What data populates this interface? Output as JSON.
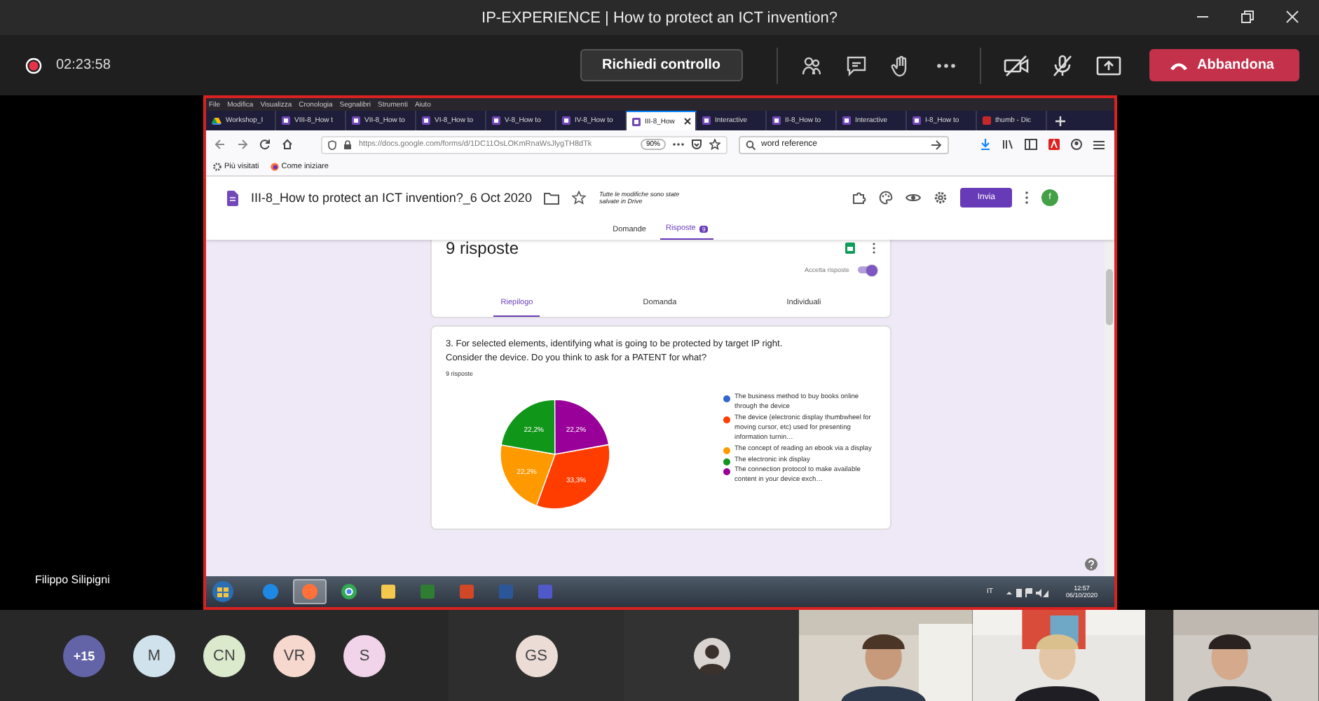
{
  "window": {
    "title": "IP-EXPERIENCE | How to protect an ICT invention?"
  },
  "call_bar": {
    "elapsed": "02:23:58",
    "request_button": "Richiedi controllo",
    "leave_button": "Abbandona"
  },
  "presenter": {
    "name": "Filippo Silipigni"
  },
  "shared_screen": {
    "menu": [
      "File",
      "Modifica",
      "Visualizza",
      "Cronologia",
      "Segnalibri",
      "Strumenti",
      "Aiuto"
    ],
    "tabs": [
      {
        "label": "Workshop_I",
        "kind": "drive",
        "selected": false
      },
      {
        "label": "VIII-8_How t",
        "kind": "forms",
        "selected": false
      },
      {
        "label": "VII-8_How to",
        "kind": "forms",
        "selected": false
      },
      {
        "label": "VI-8_How to",
        "kind": "forms",
        "selected": false
      },
      {
        "label": "V-8_How to",
        "kind": "forms",
        "selected": false
      },
      {
        "label": "IV-8_How to",
        "kind": "forms",
        "selected": false
      },
      {
        "label": "III-8_How",
        "kind": "forms",
        "selected": true
      },
      {
        "label": "Interactive",
        "kind": "forms",
        "selected": false
      },
      {
        "label": "II-8_How to",
        "kind": "forms",
        "selected": false
      },
      {
        "label": "Interactive",
        "kind": "forms",
        "selected": false
      },
      {
        "label": "I-8_How to",
        "kind": "forms",
        "selected": false
      },
      {
        "label": "thumb - Dic",
        "kind": "dictionary",
        "selected": false
      }
    ],
    "address": {
      "url": "https://docs.google.com/forms/d/1DC11OsLOKmRnaWsJlygTH8dTk",
      "zoom": "90%"
    },
    "search": {
      "value": "word reference"
    },
    "bookmarks": [
      "Più visitati",
      "Come iniziare"
    ],
    "form": {
      "title": "III-8_How to protect an ICT invention?_6 Oct 2020",
      "save_status": "Tutte le modifiche sono state salvate in Drive",
      "send_button": "Invia",
      "account_initial": "f",
      "tabs": [
        {
          "label": "Domande",
          "selected": false
        },
        {
          "label": "Risposte",
          "selected": true,
          "badge": "9"
        }
      ],
      "summary": {
        "count": "9 risposte",
        "accepting_label": "Accetta risposte",
        "accepting": true,
        "tabs": [
          {
            "label": "Riepilogo",
            "selected": true
          },
          {
            "label": "Domanda",
            "selected": false
          },
          {
            "label": "Individuali",
            "selected": false
          }
        ]
      },
      "question": {
        "text": "3. For selected elements, identifying what is going to be protected by target IP right. Consider the device. Do you think to ask for a PATENT for what?",
        "responses": "9 risposte",
        "chart_data": {
          "type": "pie",
          "legend": "right",
          "value_labels": [
            null,
            "33,3%",
            "22,2%",
            "22,2%",
            "22,2%"
          ],
          "categories": [
            "The business method to buy books online through the device",
            "The device (electronic display thumbwheel for moving cursor, etc) used for presenting information turnin…",
            "The concept of reading an ebook via a display",
            "The electronic ink display",
            "The connection protocol to make available content in your device exch…"
          ],
          "values": [
            0,
            33.3,
            22.2,
            22.2,
            22.2
          ],
          "colors": [
            "#3366cc",
            "#ff3d00",
            "#ff9900",
            "#109618",
            "#990099"
          ]
        }
      }
    },
    "taskbar": {
      "apps": [
        {
          "kind": "ie",
          "selected": false
        },
        {
          "kind": "firefox",
          "selected": true
        },
        {
          "kind": "chrome",
          "selected": false
        },
        {
          "kind": "folder",
          "selected": false
        },
        {
          "kind": "app",
          "selected": false
        },
        {
          "kind": "slides",
          "selected": false
        },
        {
          "kind": "doc",
          "selected": false
        },
        {
          "kind": "chat",
          "selected": false
        }
      ],
      "language": "IT",
      "time": "12:57",
      "date": "06/10/2020"
    }
  },
  "participants": {
    "overflow": "+15",
    "avatars": [
      {
        "initials": "M",
        "color": "#d0e3ec"
      },
      {
        "initials": "CN",
        "color": "#dbeacd"
      },
      {
        "initials": "VR",
        "color": "#f6d8cf"
      },
      {
        "initials": "S",
        "color": "#f1d4ea"
      }
    ],
    "tile": {
      "initials": "GS",
      "color": "#ebdcd6"
    }
  }
}
